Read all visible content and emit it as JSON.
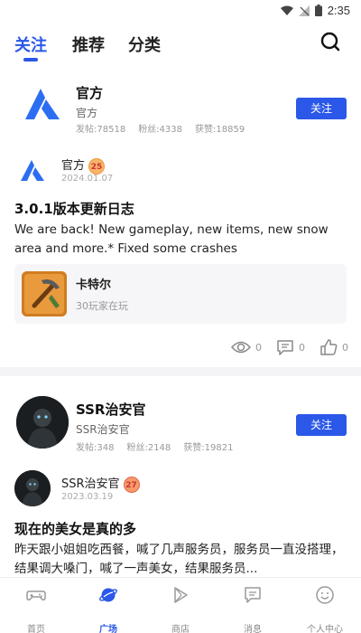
{
  "status_bar": {
    "time": "2:35"
  },
  "top_tabs": [
    {
      "label": "关注",
      "active": true
    },
    {
      "label": "推荐",
      "active": false
    },
    {
      "label": "分类",
      "active": false
    }
  ],
  "posts": [
    {
      "author": {
        "name": "官方",
        "subtitle": "官方",
        "stats": {
          "posts": "发帖:78518",
          "fans": "粉丝:4338",
          "likes": "获赞:18859"
        },
        "follow_label": "关注"
      },
      "poster": {
        "name": "官方",
        "level": "25",
        "date": "2024.01.07"
      },
      "title": "3.0.1版本更新日志",
      "body": "We are back! New gameplay, new items, new snow area and more.* Fixed some crashes",
      "game": {
        "name": "卡特尔",
        "players": "30玩家在玩"
      },
      "counts": {
        "views": "0",
        "comments": "0",
        "likes": "0"
      }
    },
    {
      "author": {
        "name": "SSR治安官",
        "subtitle": "SSR治安官",
        "stats": {
          "posts": "发帖:348",
          "fans": "粉丝:2148",
          "likes": "获赞:19821"
        },
        "follow_label": "关注"
      },
      "poster": {
        "name": "SSR治安官",
        "level": "27",
        "date": "2023.03.19"
      },
      "title": "现在的美女是真的多",
      "body": "昨天跟小姐姐吃西餐，喊了几声服务员，服务员一直没搭理，结果调大嗓门，喊了一声美女，结果服务员..."
    }
  ],
  "bottom_nav": [
    {
      "label": "首页",
      "icon": "gamepad-icon",
      "active": false
    },
    {
      "label": "广场",
      "icon": "planet-icon",
      "active": true
    },
    {
      "label": "商店",
      "icon": "play-store-icon",
      "active": false
    },
    {
      "label": "消息",
      "icon": "message-icon",
      "active": false
    },
    {
      "label": "个人中心",
      "icon": "smile-icon",
      "active": false
    }
  ],
  "colors": {
    "accent": "#2b58e8"
  }
}
